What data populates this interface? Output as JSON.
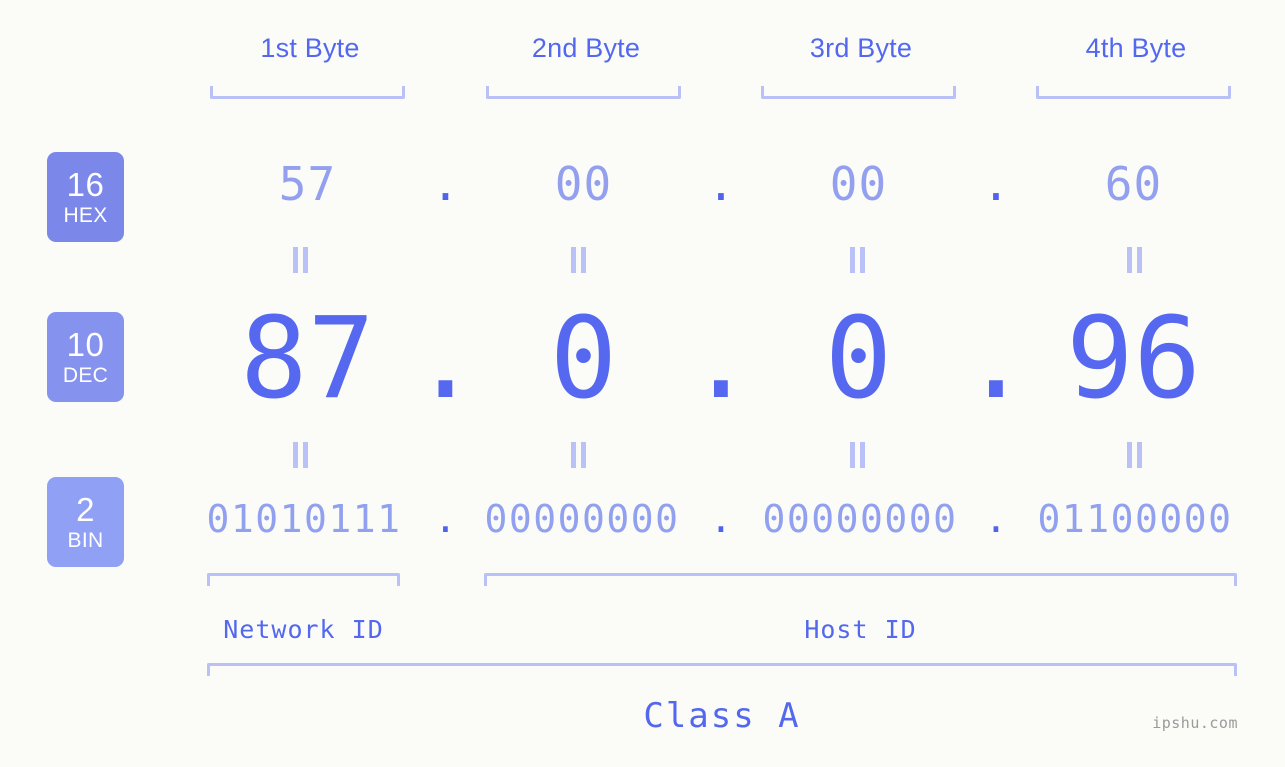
{
  "watermark": "ipshu.com",
  "byte_headers": [
    {
      "label": "1st Byte"
    },
    {
      "label": "2nd Byte"
    },
    {
      "label": "3rd Byte"
    },
    {
      "label": "4th Byte"
    }
  ],
  "radix_badges": [
    {
      "num": "16",
      "tag": "HEX",
      "color": "#7b88ea"
    },
    {
      "num": "10",
      "tag": "DEC",
      "color": "#8693ee"
    },
    {
      "num": "2",
      "tag": "BIN",
      "color": "#8fa0f5"
    }
  ],
  "rows": {
    "hex": {
      "radix": "16",
      "name": "HEX",
      "values": [
        "57",
        "00",
        "00",
        "60"
      ],
      "separator": "."
    },
    "dec": {
      "radix": "10",
      "name": "DEC",
      "values": [
        "87",
        "0",
        "0",
        "96"
      ],
      "separator": "."
    },
    "bin": {
      "radix": "2",
      "name": "BIN",
      "values": [
        "01010111",
        "00000000",
        "00000000",
        "01100000"
      ],
      "separator": "."
    }
  },
  "equals_marks": {
    "symbol": "=",
    "count_per_gap": 4
  },
  "segments": {
    "network_id": "Network ID",
    "host_id": "Host ID"
  },
  "class_label": "Class A",
  "colors": {
    "background": "#fbfcf8",
    "heading_blue": "#5368ef",
    "light_blue": "#93a0ef",
    "bracket_blue": "#b9c1f7",
    "strong_blue": "#5668f0",
    "badge_hex": "#7b88ea",
    "badge_dec": "#8693ee",
    "badge_bin": "#8fa0f5",
    "watermark_gray": "#9a9a9a"
  }
}
